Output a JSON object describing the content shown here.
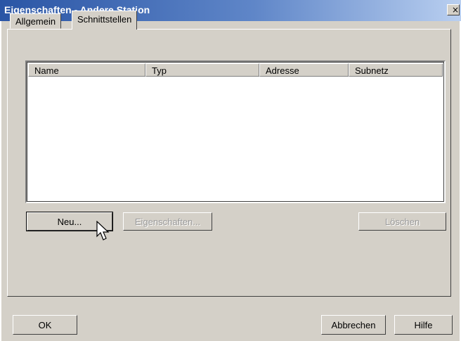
{
  "window": {
    "title": "Eigenschaften - Andere Station",
    "close_glyph": "×"
  },
  "tabs": [
    {
      "label": "Allgemein",
      "active": false
    },
    {
      "label": "Schnittstellen",
      "active": true
    }
  ],
  "list": {
    "columns": [
      "Name",
      "Typ",
      "Adresse",
      "Subnetz"
    ],
    "rows": []
  },
  "buttons": {
    "new": "Neu...",
    "properties": "Eigenschaften...",
    "delete": "Löschen",
    "ok": "OK",
    "cancel": "Abbrechen",
    "help": "Hilfe"
  },
  "icons": {
    "close": "close-icon",
    "pointer": "mouse-pointer-icon"
  },
  "colors": {
    "face": "#d4d0c8",
    "title_start": "#2a55a5",
    "title_end": "#b9cff0",
    "disabled_text": "#9a9a9a"
  }
}
